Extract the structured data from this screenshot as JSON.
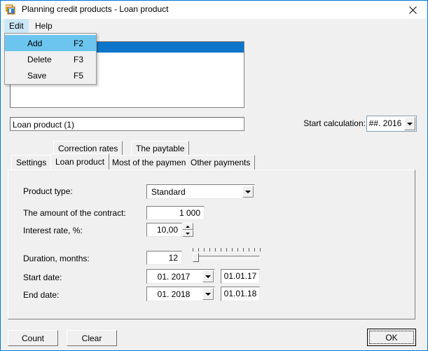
{
  "window": {
    "title": "Planning credit products - Loan product",
    "icon": "windows-cascade-icon",
    "close_label": "✕"
  },
  "menubar": {
    "items": [
      {
        "label": "Edit",
        "open": true
      },
      {
        "label": "Help",
        "open": false
      }
    ]
  },
  "edit_menu": {
    "items": [
      {
        "label": "Add",
        "shortcut": "F2",
        "selected": true
      },
      {
        "label": "Delete",
        "shortcut": "F3",
        "selected": false
      },
      {
        "label": "Save",
        "shortcut": "F5",
        "selected": false
      }
    ]
  },
  "product_list": {
    "rows": [
      {
        "text": "",
        "selected": true
      }
    ]
  },
  "name_field": {
    "value": "Loan product (1)"
  },
  "start_calculation": {
    "label": "Start calculation:",
    "value": "##. 2016"
  },
  "tabs": {
    "row_top": [
      {
        "label": "Correction rates",
        "active": false
      },
      {
        "label": "The paytable",
        "active": false
      }
    ],
    "row_bottom": [
      {
        "label": "Settings",
        "active": false
      },
      {
        "label": "Loan product",
        "active": true
      },
      {
        "label": "Most of the payments",
        "active": false
      },
      {
        "label": "Other payments",
        "active": false
      }
    ]
  },
  "form": {
    "product_type": {
      "label": "Product type:",
      "value": "Standard"
    },
    "amount": {
      "label": "The amount of the contract:",
      "value": "1 000"
    },
    "interest_rate": {
      "label": "Interest rate, %:",
      "value": "10,00"
    },
    "duration": {
      "label": "Duration, months:",
      "value": "12"
    },
    "start_date": {
      "label": "Start date:",
      "month_value": "01. 2017",
      "date_value": "01.01.17"
    },
    "end_date": {
      "label": "End date:",
      "month_value": "01. 2018",
      "date_value": "01.01.18"
    }
  },
  "footer": {
    "count_label": "Count",
    "clear_label": "Clear",
    "ok_label": "OK"
  },
  "colors": {
    "window_border": "#0078d7",
    "menu_highlight": "#cce8f7",
    "menu_item_selected": "#6cc5ee",
    "list_selection": "#0d76cb",
    "face": "#f0f0f0"
  }
}
